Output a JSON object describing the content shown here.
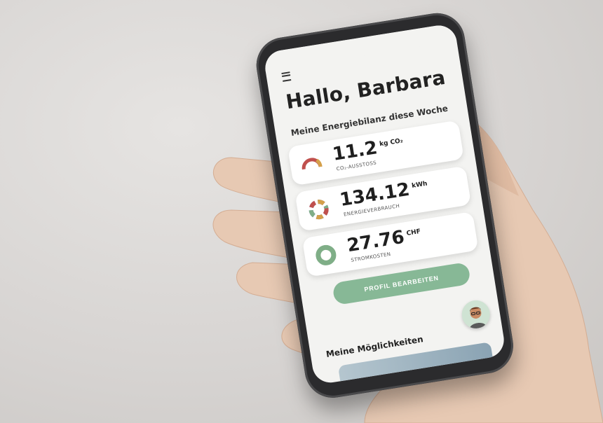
{
  "app": {
    "greeting": "Hallo, Barbara",
    "section_title": "Meine Energiebilanz diese Woche",
    "cards": [
      {
        "value": "11.2",
        "unit": "kg CO₂",
        "label": "CO₂-AUSSTOSS"
      },
      {
        "value": "134.12",
        "unit": "kWh",
        "label": "ENERGIEVERBRAUCH"
      },
      {
        "value": "27.76",
        "unit": "CHF",
        "label": "STROMKOSTEN"
      }
    ],
    "edit_profile_button": "PROFIL BEARBEITEN",
    "section2_title": "Meine Möglichkeiten"
  },
  "colors": {
    "accent": "#87b896",
    "gauge_red": "#c0504d",
    "gauge_green": "#7fae87"
  }
}
